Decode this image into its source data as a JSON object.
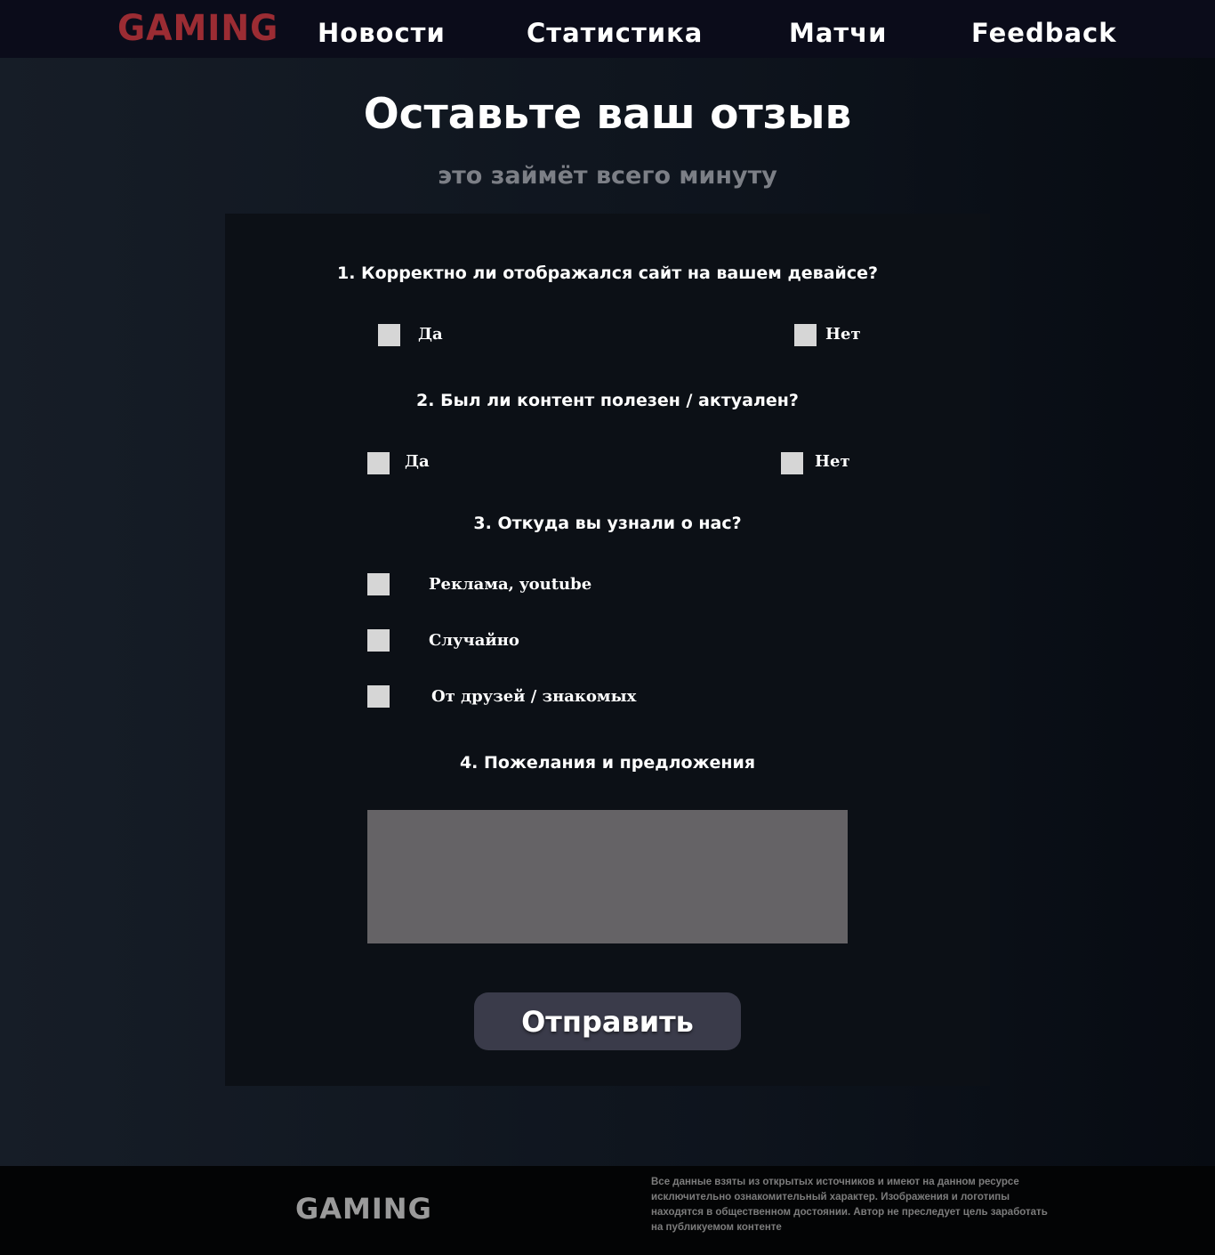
{
  "header": {
    "logo": "GAMING",
    "nav": [
      "Новости",
      "Статистика",
      "Матчи",
      "Feedback"
    ]
  },
  "page": {
    "title": "Оставьте ваш отзыв",
    "subtitle": "это займёт всего минуту"
  },
  "form": {
    "q1": {
      "label": "1. Корректно ли отображался сайт на вашем девайсе?",
      "options": [
        "Да",
        "Нет"
      ]
    },
    "q2": {
      "label": "2. Был ли контент полезен / актуален?",
      "options": [
        "Да",
        "Нет"
      ]
    },
    "q3": {
      "label": "3. Откуда вы узнали о нас?",
      "options": [
        "Реклама, youtube",
        "Случайно",
        "От друзей / знакомых"
      ]
    },
    "q4": {
      "label": "4. Пожелания и предложения",
      "textarea_value": ""
    },
    "submit_label": "Отправить"
  },
  "footer": {
    "logo": "GAMING",
    "disclaimer": "Все данные взяты из открытых источников и имеют на данном ресурсе исключительно ознакомительный характер. Изображения и логотипы находятся в общественном достоянии. Автор не преследует цель заработать на публикуемом контенте"
  },
  "colors": {
    "accent_logo": "#9b2c33",
    "panel": "#0c1016",
    "checkbox": "#d6d6d6",
    "button": "#3a3b4a"
  }
}
